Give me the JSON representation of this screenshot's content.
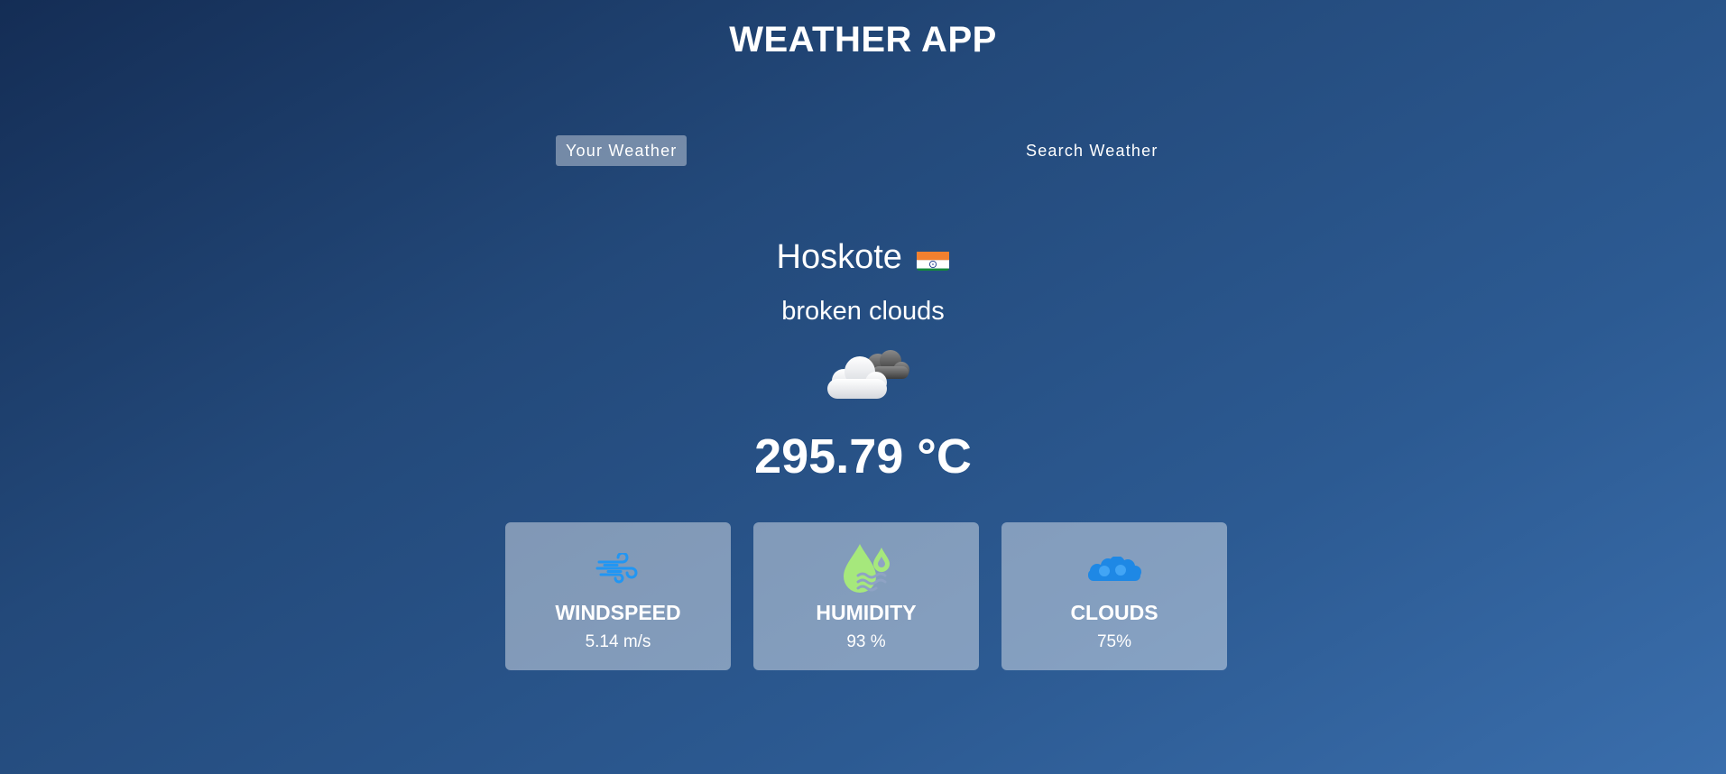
{
  "app": {
    "title": "WEATHER APP"
  },
  "tabs": [
    {
      "label": "Your Weather",
      "active": true
    },
    {
      "label": "Search Weather",
      "active": false
    }
  ],
  "weather": {
    "city": "Hoskote",
    "country_flag": "india-flag",
    "description": "broken clouds",
    "icon": "broken-clouds-icon",
    "temperature": "295.79 °C"
  },
  "stats": [
    {
      "icon": "wind-icon",
      "label": "WINDSPEED",
      "value": "5.14 m/s",
      "icon_color": "#2196f3"
    },
    {
      "icon": "humidity-icon",
      "label": "HUMIDITY",
      "value": "93 %",
      "icon_color": "#a6e87c"
    },
    {
      "icon": "clouds-icon",
      "label": "CLOUDS",
      "value": "75%",
      "icon_color": "#1e88e5"
    }
  ]
}
